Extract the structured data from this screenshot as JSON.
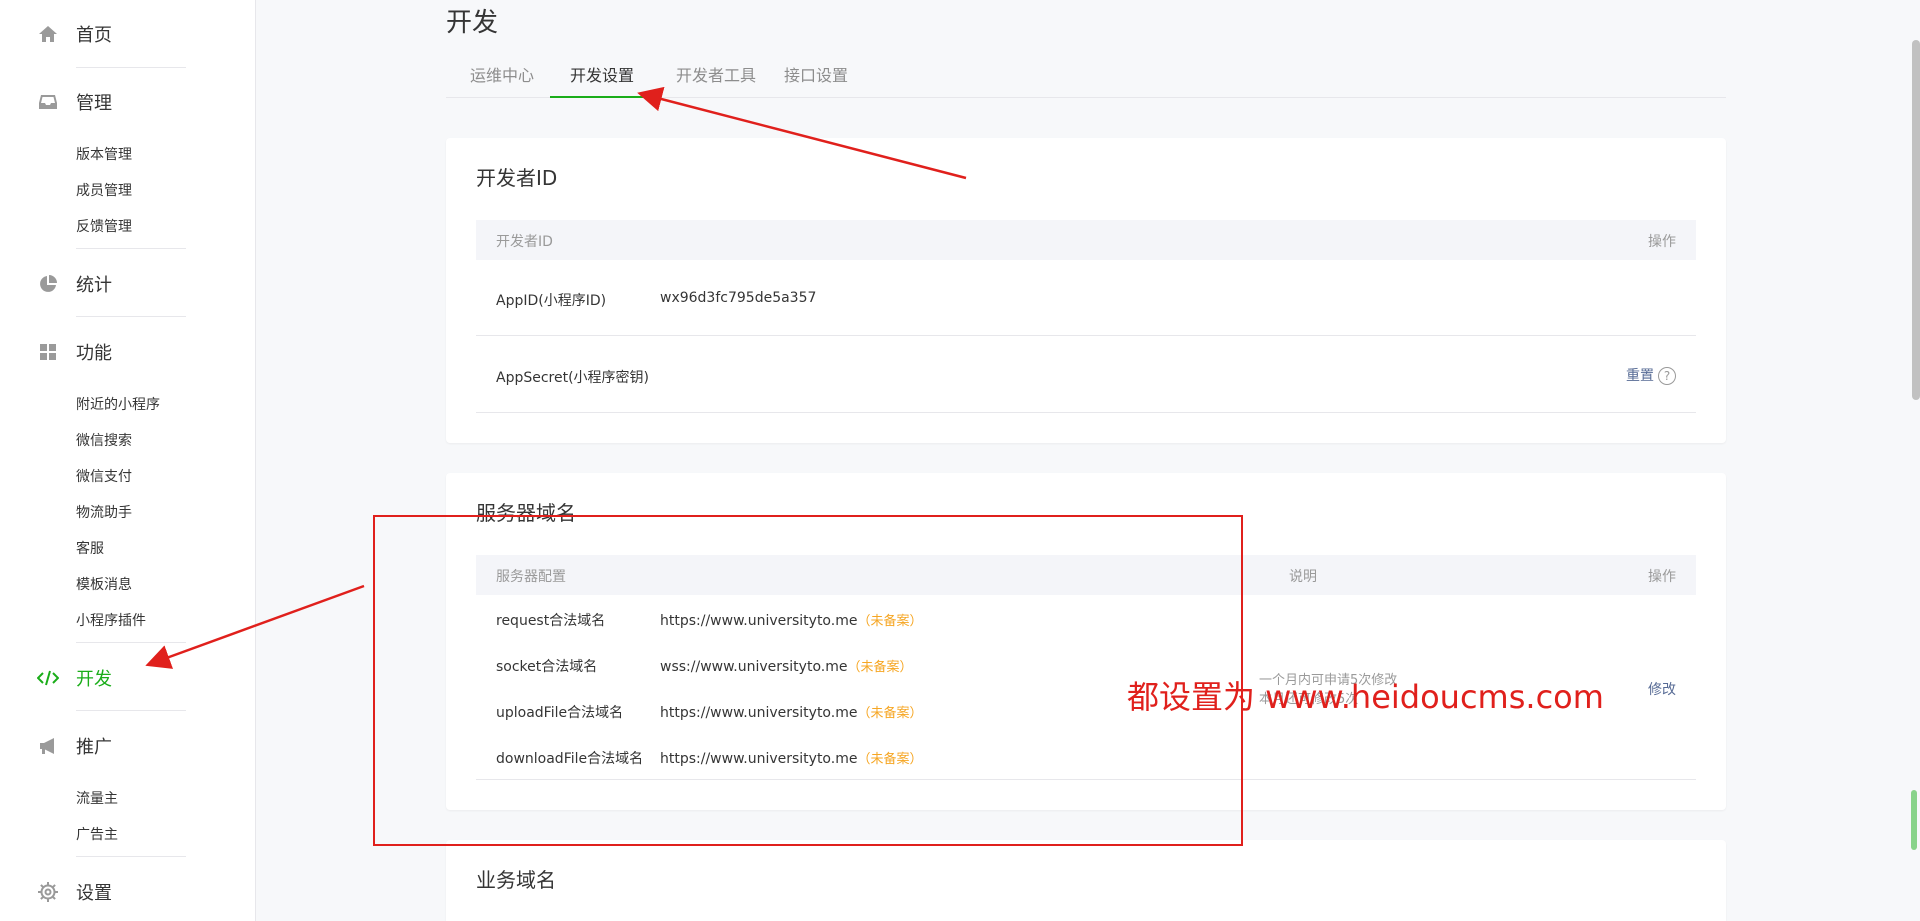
{
  "sidebar": {
    "home": "首页",
    "manage": {
      "label": "管理",
      "items": [
        "版本管理",
        "成员管理",
        "反馈管理"
      ]
    },
    "stats": "统计",
    "features": {
      "label": "功能",
      "items": [
        "附近的小程序",
        "微信搜索",
        "微信支付",
        "物流助手",
        "客服",
        "模板消息",
        "小程序插件"
      ]
    },
    "dev": "开发",
    "promote": {
      "label": "推广",
      "items": [
        "流量主",
        "广告主"
      ]
    },
    "settings": "设置"
  },
  "page_title": "开发",
  "tabs": [
    "运维中心",
    "开发设置",
    "开发者工具",
    "接口设置"
  ],
  "active_tab": "开发设置",
  "dev_id": {
    "title": "开发者ID",
    "col_name": "开发者ID",
    "col_action": "操作",
    "appid_label": "AppID(小程序ID)",
    "appid_value": "wx96d3fc795de5a357",
    "secret_label": "AppSecret(小程序密钥)",
    "secret_action": "重置",
    "help": "?"
  },
  "server": {
    "title": "服务器域名",
    "col_config": "服务器配置",
    "col_desc": "说明",
    "col_action": "操作",
    "rows": [
      {
        "name": "request合法域名",
        "value": "https://www.universityto.me",
        "tag": "（未备案）"
      },
      {
        "name": "socket合法域名",
        "value": "wss://www.universityto.me",
        "tag": "（未备案）"
      },
      {
        "name": "uploadFile合法域名",
        "value": "https://www.universityto.me",
        "tag": "（未备案）"
      },
      {
        "name": "downloadFile合法域名",
        "value": "https://www.universityto.me",
        "tag": "（未备案）"
      }
    ],
    "desc_line1": "一个月内可申请5次修改",
    "desc_line2": "本月还可修改5次",
    "modify": "修改"
  },
  "business": {
    "title": "业务域名"
  },
  "annotation": {
    "text": "都设置为 www.heidoucms.com",
    "color": "#e0201c"
  },
  "colors": {
    "accent": "#1aad19",
    "link": "#576b95",
    "warning": "#f6a623"
  }
}
